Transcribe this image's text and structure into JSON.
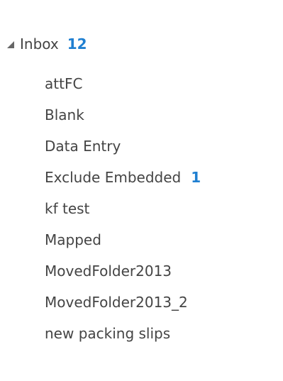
{
  "folder_pane": {
    "inbox": {
      "label": "Inbox",
      "unread_count": "12",
      "expand_icon": "collapse-triangle-icon"
    },
    "subfolders": [
      {
        "label": "attFC",
        "unread_count": ""
      },
      {
        "label": "Blank",
        "unread_count": ""
      },
      {
        "label": "Data Entry",
        "unread_count": ""
      },
      {
        "label": "Exclude Embedded",
        "unread_count": "1"
      },
      {
        "label": "kf test",
        "unread_count": ""
      },
      {
        "label": "Mapped",
        "unread_count": ""
      },
      {
        "label": "MovedFolder2013",
        "unread_count": ""
      },
      {
        "label": "MovedFolder2013_2",
        "unread_count": ""
      },
      {
        "label": "new packing slips",
        "unread_count": ""
      }
    ]
  },
  "colors": {
    "text": "#444444",
    "unread_count": "#1f7fd1",
    "background": "#ffffff"
  }
}
